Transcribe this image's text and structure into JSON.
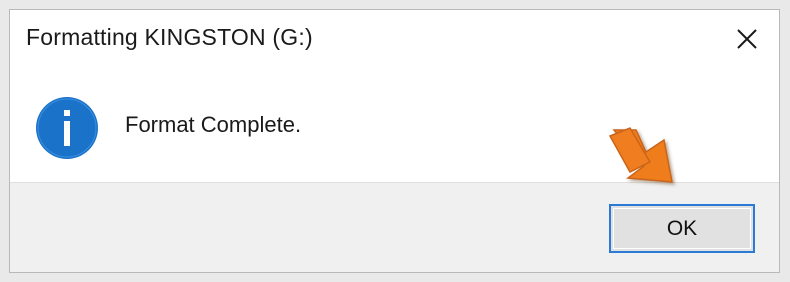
{
  "dialog": {
    "title": "Formatting KINGSTON (G:)",
    "message": "Format Complete.",
    "ok_label": "OK"
  },
  "icons": {
    "info": "info-icon",
    "close": "close-icon",
    "pointer": "arrow-pointer-icon"
  },
  "colors": {
    "info_blue": "#1a73c9",
    "focus_border": "#2b7ad6",
    "arrow_orange": "#f07d1f"
  }
}
